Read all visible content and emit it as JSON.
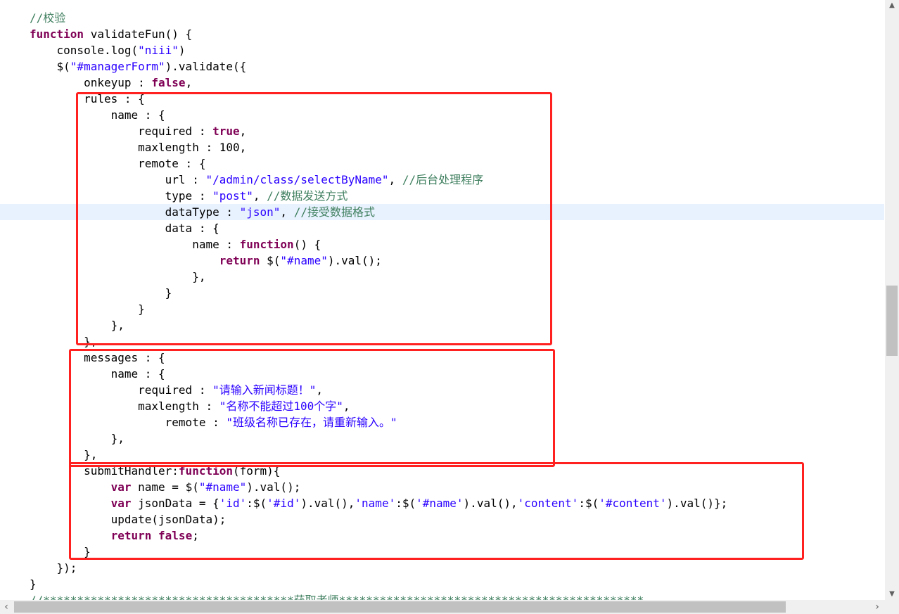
{
  "editor": {
    "current_line_index": 12,
    "lines": [
      [
        {
          "t": "cm",
          "v": "//校验"
        }
      ],
      [
        {
          "t": "kw",
          "v": "function"
        },
        {
          "t": "pl",
          "v": " validateFun() {"
        }
      ],
      [
        {
          "t": "pl",
          "v": "    console.log("
        },
        {
          "t": "str",
          "v": "\"niii\""
        },
        {
          "t": "pl",
          "v": ")"
        }
      ],
      [
        {
          "t": "pl",
          "v": "    $("
        },
        {
          "t": "str",
          "v": "\"#managerForm\""
        },
        {
          "t": "pl",
          "v": ").validate({"
        }
      ],
      [
        {
          "t": "pl",
          "v": "        onkeyup : "
        },
        {
          "t": "kw",
          "v": "false"
        },
        {
          "t": "pl",
          "v": ","
        }
      ],
      [
        {
          "t": "pl",
          "v": "        rules : {"
        }
      ],
      [
        {
          "t": "pl",
          "v": "            name : {"
        }
      ],
      [
        {
          "t": "pl",
          "v": "                required : "
        },
        {
          "t": "kw",
          "v": "true"
        },
        {
          "t": "pl",
          "v": ","
        }
      ],
      [
        {
          "t": "pl",
          "v": "                maxlength : 100,"
        }
      ],
      [
        {
          "t": "pl",
          "v": "                remote : {"
        }
      ],
      [
        {
          "t": "pl",
          "v": "                    url : "
        },
        {
          "t": "str",
          "v": "\"/admin/class/selectByName\""
        },
        {
          "t": "pl",
          "v": ", "
        },
        {
          "t": "cm",
          "v": "//后台处理程序"
        }
      ],
      [
        {
          "t": "pl",
          "v": "                    type : "
        },
        {
          "t": "str",
          "v": "\"post\""
        },
        {
          "t": "pl",
          "v": ", "
        },
        {
          "t": "cm",
          "v": "//数据发送方式"
        }
      ],
      [
        {
          "t": "pl",
          "v": "                    dataType : "
        },
        {
          "t": "str",
          "v": "\"json\""
        },
        {
          "t": "pl",
          "v": ", "
        },
        {
          "t": "cm",
          "v": "//接受数据格式"
        }
      ],
      [
        {
          "t": "pl",
          "v": "                    data : {"
        }
      ],
      [
        {
          "t": "pl",
          "v": "                        name : "
        },
        {
          "t": "kw",
          "v": "function"
        },
        {
          "t": "pl",
          "v": "() {"
        }
      ],
      [
        {
          "t": "pl",
          "v": "                            "
        },
        {
          "t": "kw",
          "v": "return"
        },
        {
          "t": "pl",
          "v": " $("
        },
        {
          "t": "str",
          "v": "\"#name\""
        },
        {
          "t": "pl",
          "v": ").val();"
        }
      ],
      [
        {
          "t": "pl",
          "v": "                        },"
        }
      ],
      [
        {
          "t": "pl",
          "v": "                    }"
        }
      ],
      [
        {
          "t": "pl",
          "v": "                }"
        }
      ],
      [
        {
          "t": "pl",
          "v": "            },"
        }
      ],
      [
        {
          "t": "pl",
          "v": "        },"
        }
      ],
      [
        {
          "t": "pl",
          "v": "        messages : {"
        }
      ],
      [
        {
          "t": "pl",
          "v": "            name : {"
        }
      ],
      [
        {
          "t": "pl",
          "v": "                required : "
        },
        {
          "t": "str",
          "v": "\"请输入新闻标题！\""
        },
        {
          "t": "pl",
          "v": ","
        }
      ],
      [
        {
          "t": "pl",
          "v": "                maxlength : "
        },
        {
          "t": "str",
          "v": "\"名称不能超过100个字\""
        },
        {
          "t": "pl",
          "v": ","
        }
      ],
      [
        {
          "t": "pl",
          "v": "                    remote : "
        },
        {
          "t": "str",
          "v": "\"班级名称已存在，请重新输入。\""
        }
      ],
      [
        {
          "t": "pl",
          "v": "            },"
        }
      ],
      [
        {
          "t": "pl",
          "v": "        },"
        }
      ],
      [
        {
          "t": "pl",
          "v": "        submitHandler:"
        },
        {
          "t": "kw",
          "v": "function"
        },
        {
          "t": "pl",
          "v": "(form){"
        }
      ],
      [
        {
          "t": "pl",
          "v": "            "
        },
        {
          "t": "kw",
          "v": "var"
        },
        {
          "t": "pl",
          "v": " name = $("
        },
        {
          "t": "str",
          "v": "\"#name\""
        },
        {
          "t": "pl",
          "v": ").val();"
        }
      ],
      [
        {
          "t": "pl",
          "v": "            "
        },
        {
          "t": "kw",
          "v": "var"
        },
        {
          "t": "pl",
          "v": " jsonData = {"
        },
        {
          "t": "str",
          "v": "'id'"
        },
        {
          "t": "pl",
          "v": ":$("
        },
        {
          "t": "str",
          "v": "'#id'"
        },
        {
          "t": "pl",
          "v": ").val(),"
        },
        {
          "t": "str",
          "v": "'name'"
        },
        {
          "t": "pl",
          "v": ":$("
        },
        {
          "t": "str",
          "v": "'#name'"
        },
        {
          "t": "pl",
          "v": ").val(),"
        },
        {
          "t": "str",
          "v": "'content'"
        },
        {
          "t": "pl",
          "v": ":$("
        },
        {
          "t": "str",
          "v": "'#content'"
        },
        {
          "t": "pl",
          "v": ").val()};"
        }
      ],
      [
        {
          "t": "pl",
          "v": "            update(jsonData);"
        }
      ],
      [
        {
          "t": "pl",
          "v": "            "
        },
        {
          "t": "kw",
          "v": "return"
        },
        {
          "t": "pl",
          "v": " "
        },
        {
          "t": "kw",
          "v": "false"
        },
        {
          "t": "pl",
          "v": ";"
        }
      ],
      [
        {
          "t": "pl",
          "v": "        }"
        }
      ],
      [
        {
          "t": "pl",
          "v": "    });"
        }
      ],
      [
        {
          "t": "pl",
          "v": "}"
        }
      ],
      [
        {
          "t": "cm",
          "v": "//*************************************获取老师*********************************************"
        }
      ]
    ]
  },
  "scrollbars": {
    "up_arrow": "▲",
    "down_arrow": "▼",
    "left_arrow": "‹",
    "right_arrow": "›"
  },
  "colors": {
    "keyword": "#7f0055",
    "string": "#2a00ff",
    "comment": "#3f7f5f",
    "annotation_box": "#ff2020",
    "current_line": "#e8f2fe"
  }
}
